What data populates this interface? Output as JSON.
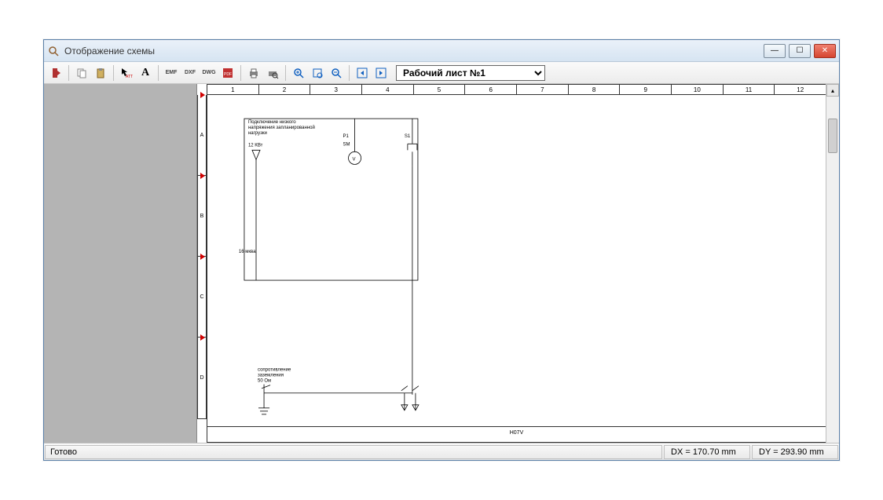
{
  "window": {
    "title": "Отображение схемы"
  },
  "toolbar": {
    "exit": "exit",
    "copy": "copy",
    "paste": "paste",
    "arrow_att": "ATT",
    "text": "A",
    "emf": "EMF",
    "dxf": "DXF",
    "dwg": "DWG",
    "pdf": "pdf",
    "print": "print",
    "preview": "preview",
    "zoom_in": "+",
    "zoom_page": "page",
    "zoom_out": "−",
    "prev": "◄",
    "next": "►",
    "sheet_label": "Рабочий лист №1"
  },
  "ruler": {
    "cols": [
      "1",
      "2",
      "3",
      "4",
      "5",
      "6",
      "7",
      "8",
      "9",
      "10",
      "11",
      "12"
    ],
    "rows": [
      "A",
      "B",
      "C",
      "D"
    ]
  },
  "schematic": {
    "title1": "Подключение низкого",
    "title2": "напряжения запланированной",
    "title3": "нагрузки",
    "load": "12 КВт",
    "p1": "P1",
    "sm": "SM",
    "s1": "S1",
    "v": "V",
    "mm": "16 мква",
    "res1": "сопротивление",
    "res2": "заземления",
    "res3": "50 Ом",
    "footer": "H07V"
  },
  "status": {
    "ready": "Готово",
    "dx": "DX = 170.70 mm",
    "dy": "DY = 293.90 mm"
  }
}
